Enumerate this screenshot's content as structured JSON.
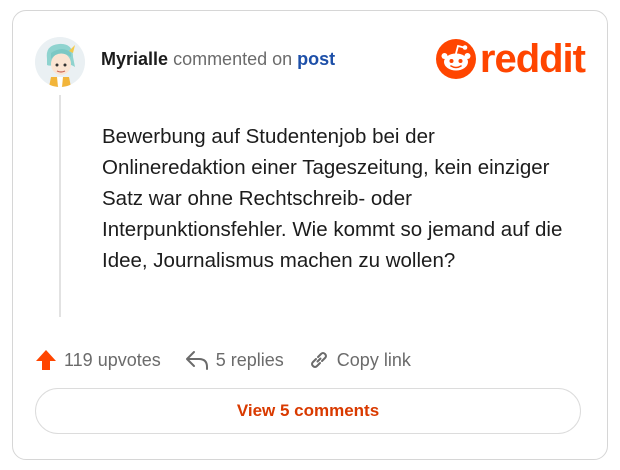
{
  "comment": {
    "author": "Myrialle",
    "action_text": "commented on",
    "target_link": "post",
    "body": "Bewerbung auf Studentenjob bei der Onlineredaktion einer Tageszeitung, kein einziger Satz war ohne Rechtschreib- oder Interpunktionsfehler. Wie kommt so jemand auf die Idee, Journalismus machen zu wollen?"
  },
  "brand": {
    "name": "reddit",
    "icon": "reddit-snoo-icon",
    "color": "#ff4500"
  },
  "actions": {
    "upvotes": "119 upvotes",
    "replies": "5 replies",
    "copy_link": "Copy link"
  },
  "view_comments_label": "View 5 comments"
}
